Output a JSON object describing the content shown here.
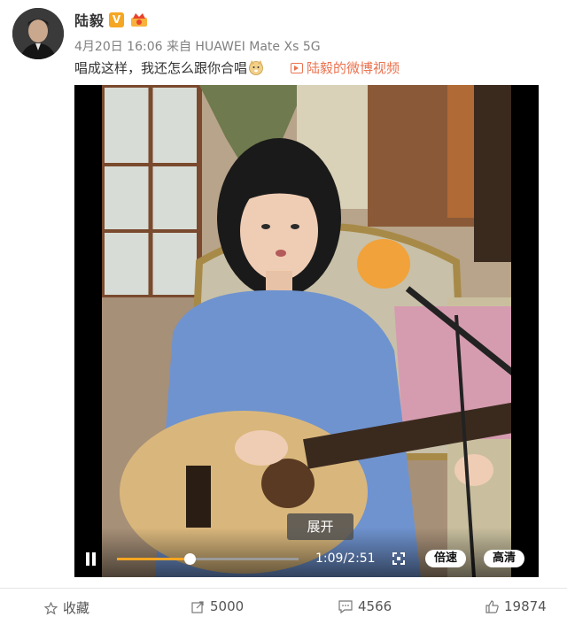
{
  "user": {
    "name": "陆毅",
    "verified_badge": "V",
    "avatar_icon": "avatar"
  },
  "post": {
    "meta": "4月20日 16:06 来自 HUAWEI Mate Xs 5G",
    "text": "唱成这样，我还怎么跟你合唱",
    "emoji_icon": "doge-emoji-icon",
    "video_link": "陆毅的微博视频"
  },
  "player": {
    "expand_label": "展开",
    "time": "1:09/2:51",
    "progress": 0.4,
    "speed_label": "倍速",
    "quality_label": "高清",
    "accent_color": "#f6a623"
  },
  "actions": {
    "favorite": "收藏",
    "share_count": "5000",
    "comment_count": "4566",
    "like_count": "19874"
  }
}
